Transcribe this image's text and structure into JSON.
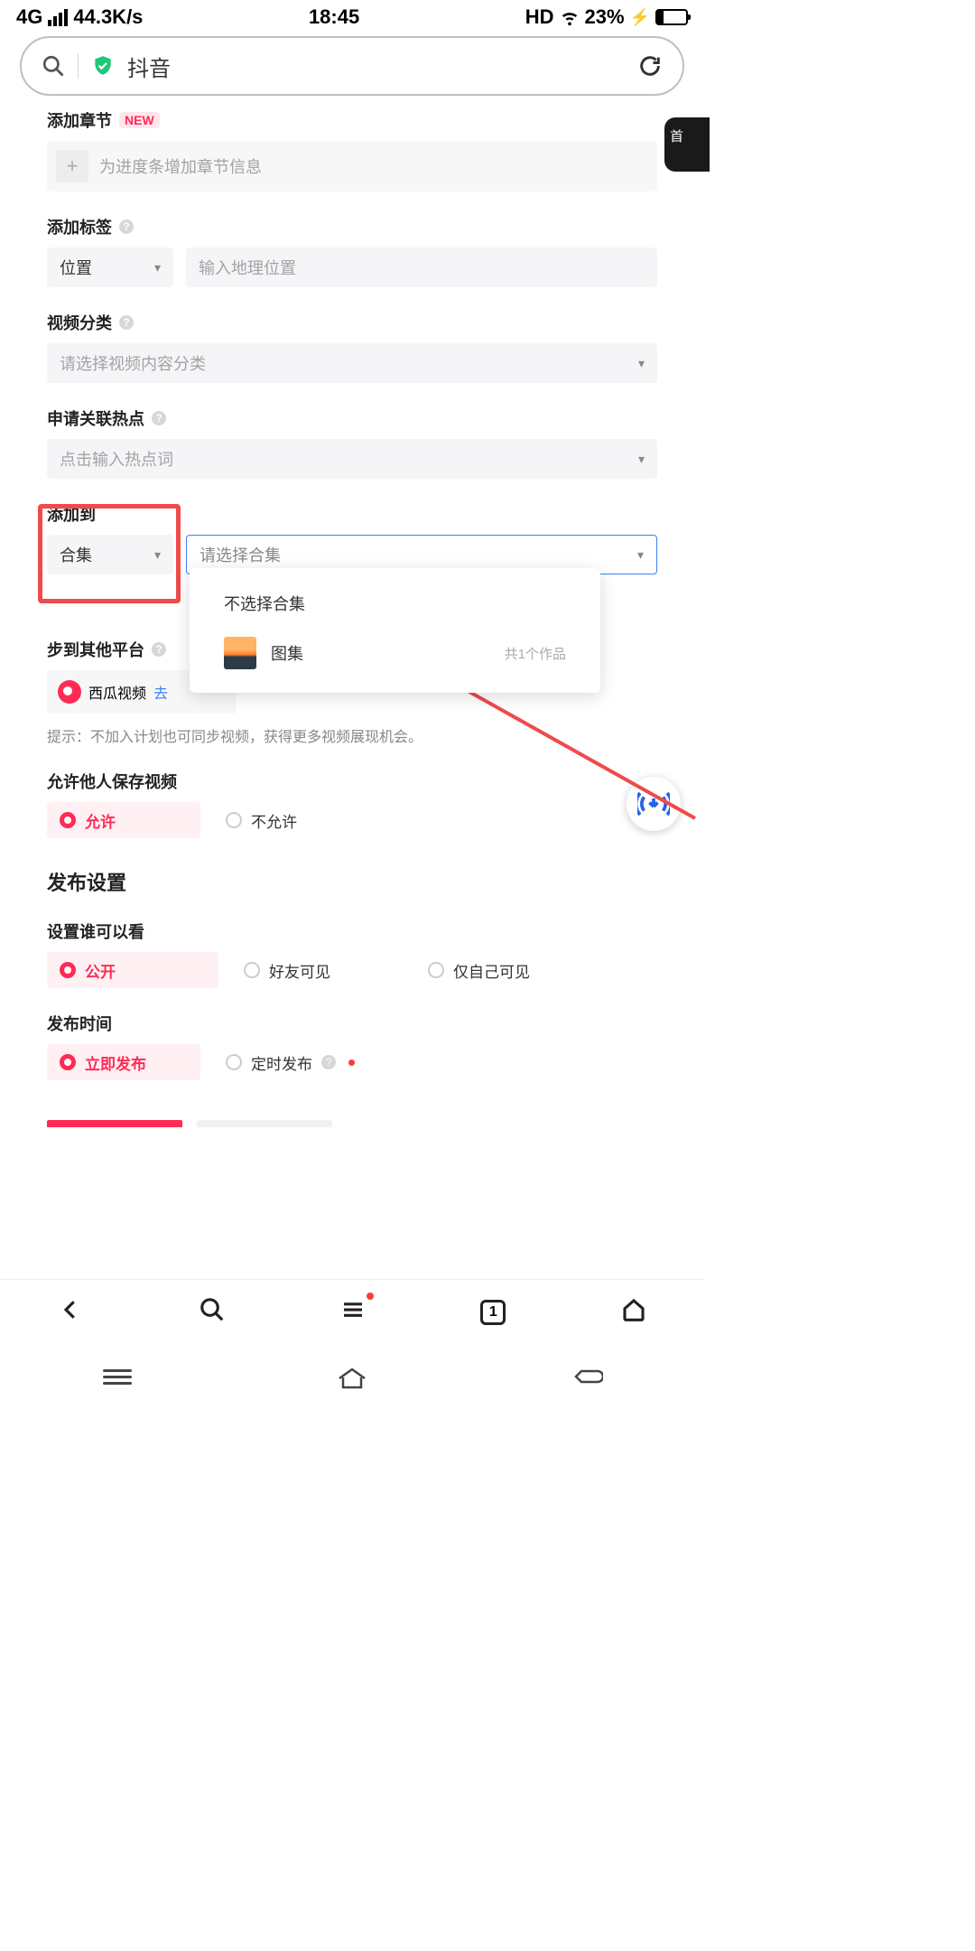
{
  "status": {
    "net": "4G",
    "speed": "44.3K/s",
    "time": "18:45",
    "hd": "HD",
    "battery_pct": "23%"
  },
  "browser": {
    "site": "抖音"
  },
  "chapter": {
    "label": "添加章节",
    "new": "NEW",
    "placeholder": "为进度条增加章节信息"
  },
  "tags": {
    "label": "添加标签",
    "location_select": "位置",
    "location_placeholder": "输入地理位置"
  },
  "category": {
    "label": "视频分类",
    "placeholder": "请选择视频内容分类"
  },
  "hot": {
    "label": "申请关联热点",
    "placeholder": "点击输入热点词"
  },
  "addto": {
    "label": "添加到",
    "type": "合集",
    "placeholder": "请选择合集"
  },
  "dropdown": {
    "none": "不选择合集",
    "item": "图集",
    "count": "共1个作品"
  },
  "sync": {
    "label_partial": "步到其他平台",
    "xigua": "西瓜视频",
    "go": "去",
    "hint": "提示：不加入计划也可同步视频，获得更多视频展现机会。"
  },
  "save": {
    "label": "允许他人保存视频",
    "allow": "允许",
    "deny": "不允许"
  },
  "publish": {
    "title": "发布设置",
    "who_label": "设置谁可以看",
    "public": "公开",
    "friends": "好友可见",
    "self": "仅自己可见",
    "time_label": "发布时间",
    "now": "立即发布",
    "schedule": "定时发布"
  },
  "float_tab": "首",
  "tabs_count": "1"
}
